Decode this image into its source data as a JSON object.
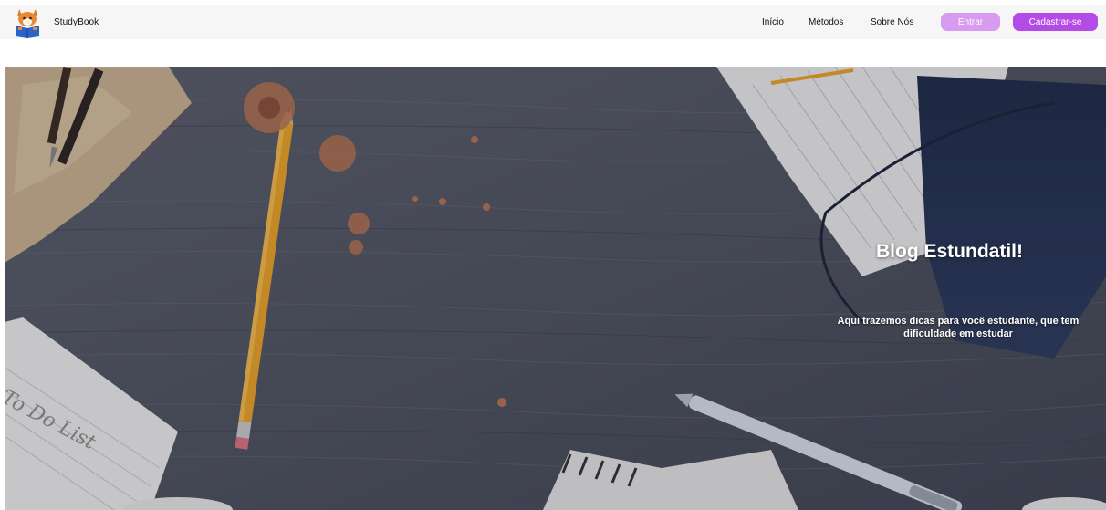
{
  "brand": {
    "name": "StudyBook",
    "logo_icon": "fox-reading-book-icon"
  },
  "nav": {
    "links": [
      "Início",
      "Métodos",
      "Sobre Nós"
    ],
    "login_label": "Entrar",
    "signup_label": "Cadastrar-se"
  },
  "hero": {
    "title": "Blog Estundatil!",
    "subtitle": "Aqui trazemos dicas para você estudante, que tem dificuldade em estudar",
    "note_text": "To Do List"
  },
  "colors": {
    "login_button": "#d79bf0",
    "signup_button": "#b44be6",
    "navbar": "#f6f6f6"
  }
}
